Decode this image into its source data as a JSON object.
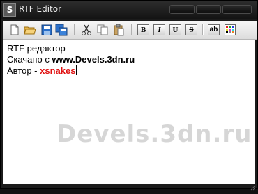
{
  "window": {
    "title": "RTF Editor",
    "app_icon_letter": "S"
  },
  "toolbar": {
    "buttons": [
      "new-file-icon",
      "open-folder-icon",
      "save-icon",
      "save-all-icon",
      "cut-icon",
      "copy-icon",
      "paste-icon"
    ],
    "bold_label": "B",
    "italic_label": "I",
    "underline_label": "U",
    "strike_label": "S",
    "font_label": "ab",
    "color_icon": "color-palette-icon"
  },
  "editor": {
    "line1": "RTF редактор",
    "line2_prefix": "Скачано с ",
    "line2_link": "www.Devels.3dn.ru",
    "line3_prefix": "Автор - ",
    "line3_author": "xsnakes",
    "author_color": "#e01010"
  },
  "watermark": "Devels.3dn.ru"
}
